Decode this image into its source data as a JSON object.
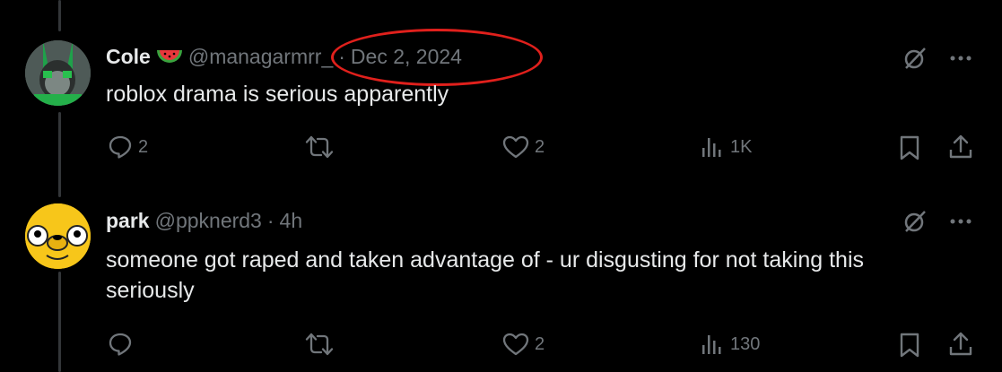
{
  "tweets": [
    {
      "name": "Cole",
      "emoji": "watermelon-emoji",
      "handle": "@managarmrr_",
      "dot": "·",
      "time": "Dec 2, 2024",
      "text": "roblox drama is serious apparently",
      "replies": "2",
      "retweets": "",
      "likes": "2",
      "views": "1K"
    },
    {
      "name": "park",
      "handle": "@ppknerd3",
      "dot": "·",
      "time": "4h",
      "text": "someone got raped and taken advantage of - ur disgusting for not taking this seriously",
      "replies": "",
      "retweets": "",
      "likes": "2",
      "views": "130"
    }
  ],
  "colors": {
    "background": "#000000",
    "text": "#e7e9ea",
    "muted": "#71767b",
    "annotation": "#e0201c"
  },
  "icons": [
    "grok-icon",
    "more-icon",
    "reply-icon",
    "retweet-icon",
    "like-icon",
    "views-icon",
    "bookmark-icon",
    "share-icon"
  ]
}
